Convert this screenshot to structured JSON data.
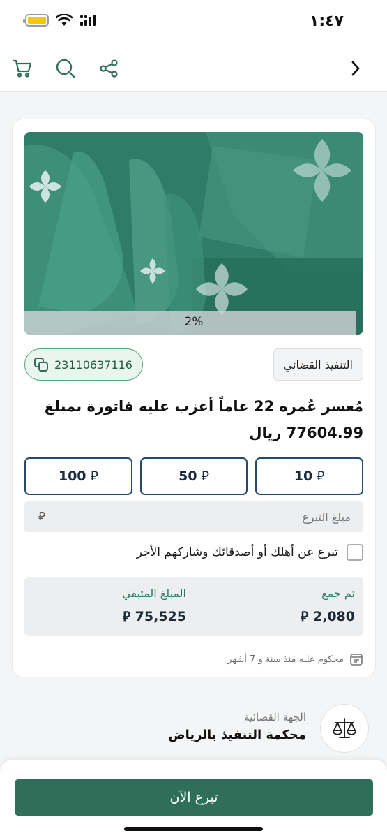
{
  "status_bar": {
    "time": "١:٤٧"
  },
  "nav": {
    "icons": [
      "cart-icon",
      "search-icon",
      "share-icon",
      "back-chevron-icon"
    ]
  },
  "case": {
    "progress": {
      "label": "2%",
      "value": 0.02
    },
    "category": "التنفيذ القضائي",
    "code": "23110637116",
    "title": "مُعسر عُمره 22 عاماً أعزب عليه فاتورة بمبلغ 77604.99 ريال"
  },
  "currency_symbol": "⃁",
  "amounts": [
    "10",
    "50",
    "100"
  ],
  "amount_input": {
    "placeholder": "مبلغ التبرع"
  },
  "gift": {
    "label": "تبرع عن أهلك أو أصدقائك وشاركهم الأجر"
  },
  "stats": {
    "collected": {
      "label": "تم جمع",
      "value": "2,080"
    },
    "remaining": {
      "label": "المبلغ المتبقي",
      "value": "75,525"
    }
  },
  "footnote": "محكوم عليه منذ سنة و 7 أشهر",
  "authority": {
    "label": "الجهة القضائية",
    "name": "محكمة التنفيذ بالرياض"
  },
  "cta": {
    "label": "تبرع الآن"
  },
  "colors": {
    "primary": "#2f6e58",
    "accent": "#2d7a5b",
    "navy": "#244b6b"
  }
}
